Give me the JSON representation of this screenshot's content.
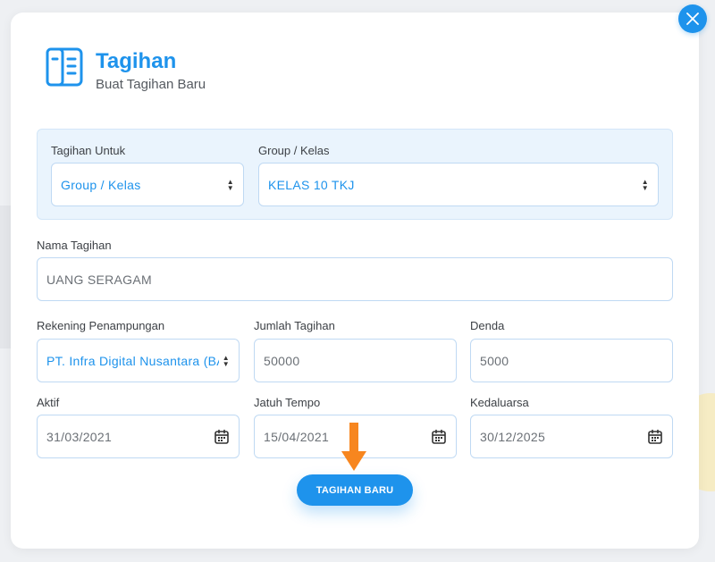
{
  "header": {
    "title": "Tagihan",
    "subtitle": "Buat Tagihan Baru",
    "icon": "document-icon"
  },
  "form": {
    "tagihan_untuk": {
      "label": "Tagihan Untuk",
      "value": "Group / Kelas"
    },
    "group_kelas": {
      "label": "Group / Kelas",
      "value": "KELAS 10 TKJ"
    },
    "nama_tagihan": {
      "label": "Nama Tagihan",
      "value": "UANG SERAGAM"
    },
    "rekening": {
      "label": "Rekening Penampungan",
      "value": "PT. Infra Digital Nusantara (BA"
    },
    "jumlah": {
      "label": "Jumlah Tagihan",
      "value": "50000"
    },
    "denda": {
      "label": "Denda",
      "value": "5000"
    },
    "aktif": {
      "label": "Aktif",
      "value": "31/03/2021"
    },
    "jatuh_tempo": {
      "label": "Jatuh Tempo",
      "value": "15/04/2021"
    },
    "kedaluarsa": {
      "label": "Kedaluarsa",
      "value": "30/12/2025"
    }
  },
  "submit_label": "TAGIHAN BARU",
  "colors": {
    "accent": "#1e93ec",
    "arrow": "#f7861f",
    "panel": "#eaf4fd"
  }
}
